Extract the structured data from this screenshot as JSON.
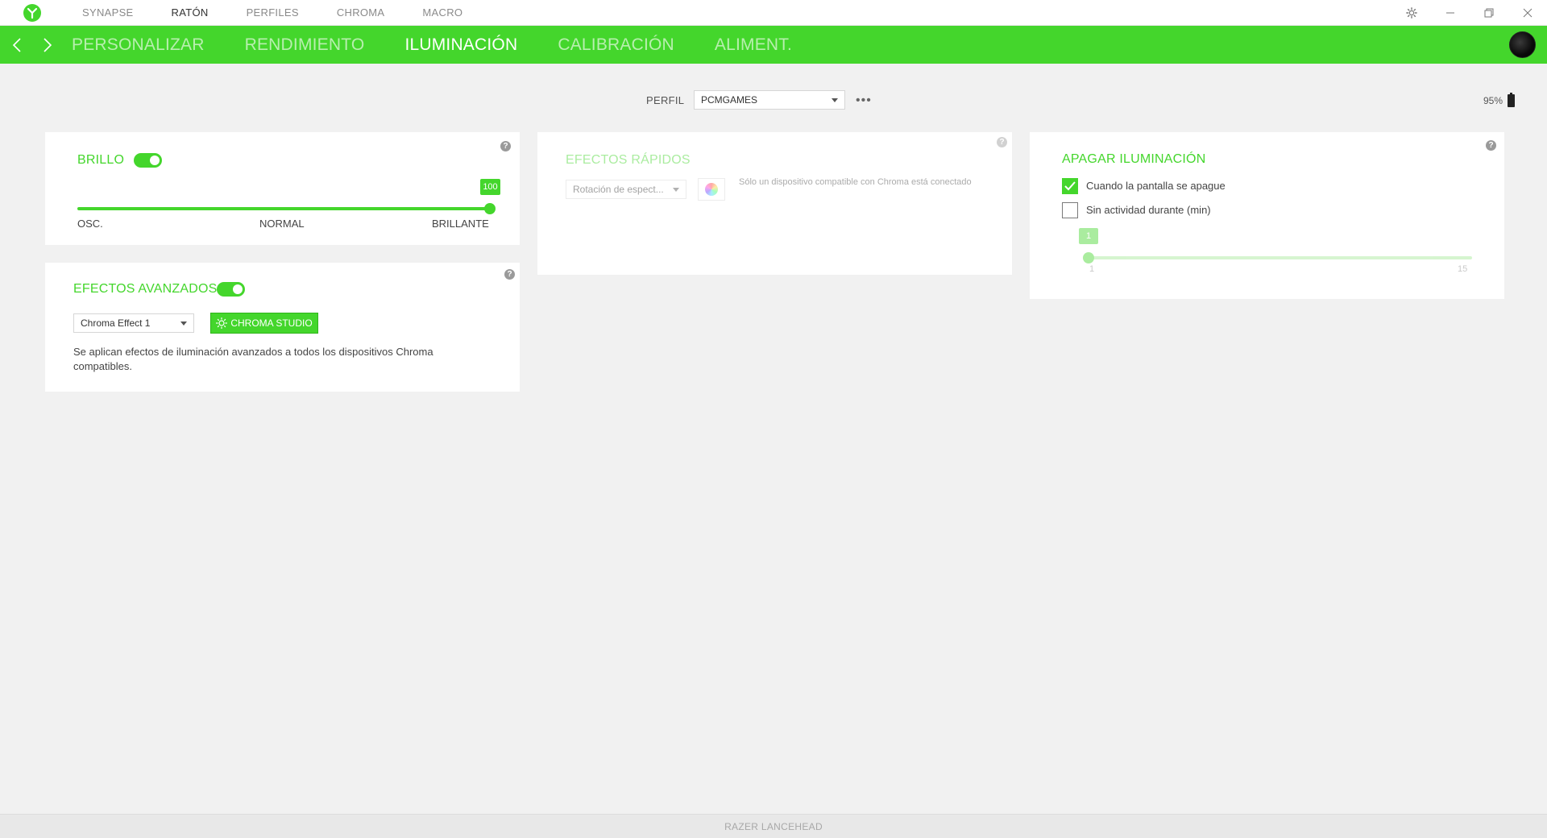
{
  "topbar": {
    "tabs": [
      {
        "label": "SYNAPSE",
        "active": false
      },
      {
        "label": "RATÓN",
        "active": true
      },
      {
        "label": "PERFILES",
        "active": false
      },
      {
        "label": "CHROMA",
        "active": false
      },
      {
        "label": "MACRO",
        "active": false
      }
    ]
  },
  "subnav": {
    "tabs": [
      {
        "label": "PERSONALIZAR",
        "active": false
      },
      {
        "label": "RENDIMIENTO",
        "active": false
      },
      {
        "label": "ILUMINACIÓN",
        "active": true
      },
      {
        "label": "CALIBRACIÓN",
        "active": false
      },
      {
        "label": "ALIMENT.",
        "active": false
      }
    ]
  },
  "profile": {
    "label": "PERFIL",
    "selected": "PCMGAMES",
    "more": "•••"
  },
  "battery": {
    "percent_text": "95%",
    "level": 0.95
  },
  "brillo": {
    "title": "BRILLO",
    "enabled": true,
    "value": 100,
    "value_text": "100",
    "min": 0,
    "max": 100,
    "labels": {
      "low": "OSC.",
      "mid": "NORMAL",
      "high": "BRILLANTE"
    },
    "help": "?"
  },
  "efectos_avanzados": {
    "title": "EFECTOS AVANZADOS",
    "enabled": true,
    "selected_effect": "Chroma Effect 1",
    "studio_button": "CHROMA STUDIO",
    "description": "Se aplican efectos de iluminación avanzados a todos los dispositivos Chroma compatibles.",
    "help": "?"
  },
  "efectos_rapidos": {
    "title": "EFECTOS RÁPIDOS",
    "selected_effect": "Rotación de espect...",
    "notice": "Sólo un dispositivo compatible con Chroma está conectado",
    "help": "?"
  },
  "apagar": {
    "title": "APAGAR ILUMINACIÓN",
    "option_screen_off": {
      "label": "Cuando la pantalla se apague",
      "checked": true
    },
    "option_idle": {
      "label": "Sin actividad durante (min)",
      "checked": false
    },
    "idle_minutes": 1,
    "idle_value_text": "1",
    "idle_min": 1,
    "idle_max": 15,
    "idle_min_text": "1",
    "idle_max_text": "15",
    "help": "?"
  },
  "footer": {
    "device_name": "RAZER LANCEHEAD"
  },
  "colors": {
    "accent": "#44d62c",
    "background": "#f1f1f1",
    "card": "#ffffff"
  }
}
